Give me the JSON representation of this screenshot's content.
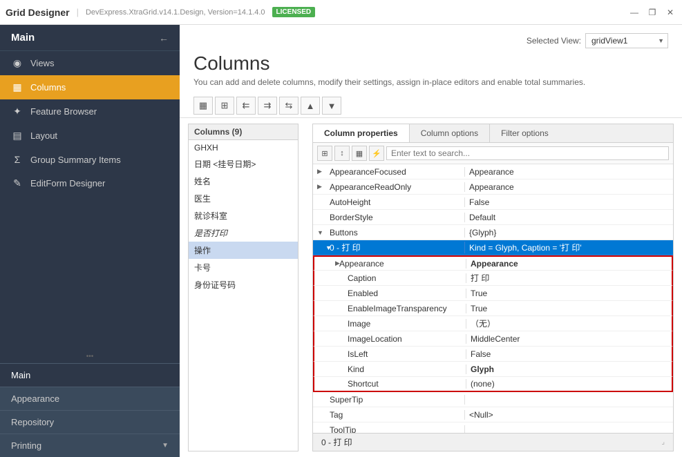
{
  "titleBar": {
    "appName": "Grid Designer",
    "subtitle": "DevExpress.XtraGrid.v14.1.Design, Version=14.1.4.0",
    "badge": "LICENSED",
    "minimizeBtn": "—",
    "restoreBtn": "❐",
    "closeBtn": "✕"
  },
  "sidebar": {
    "mainHeader": "Main",
    "arrowIcon": "←",
    "navItems": [
      {
        "id": "views",
        "icon": "◉",
        "label": "Views",
        "active": false
      },
      {
        "id": "columns",
        "icon": "▦",
        "label": "Columns",
        "active": true
      },
      {
        "id": "featureBrowser",
        "icon": "✦",
        "label": "Feature Browser",
        "active": false
      },
      {
        "id": "layout",
        "icon": "▤",
        "label": "Layout",
        "active": false
      },
      {
        "id": "groupSummaryItems",
        "icon": "Σ",
        "label": "Group Summary Items",
        "active": false
      },
      {
        "id": "editFormDesigner",
        "icon": "✎",
        "label": "EditForm Designer",
        "active": false
      }
    ],
    "accordionSections": [
      {
        "id": "main",
        "label": "Main",
        "active": true
      },
      {
        "id": "appearance",
        "label": "Appearance",
        "active": false
      },
      {
        "id": "repository",
        "label": "Repository",
        "active": false
      },
      {
        "id": "printing",
        "label": "Printing",
        "active": false
      }
    ],
    "bottomArrow": "▼"
  },
  "page": {
    "title": "Columns",
    "description": "You can add and delete columns, modify their settings, assign in-place editors and enable total summaries."
  },
  "viewSelector": {
    "label": "Selected View:",
    "value": "gridView1"
  },
  "toolbar": {
    "buttons": [
      "▦",
      "⊞",
      "⇇",
      "⇉",
      "⇆",
      "▲",
      "▼"
    ]
  },
  "columnsPanel": {
    "title": "Columns (9)",
    "items": [
      {
        "id": "ghxh",
        "label": "GHXH",
        "italic": false,
        "selected": false
      },
      {
        "id": "date",
        "label": "日期 <挂号日期>",
        "italic": false,
        "selected": false
      },
      {
        "id": "name",
        "label": "姓名",
        "italic": false,
        "selected": false
      },
      {
        "id": "doctor",
        "label": "医生",
        "italic": false,
        "selected": false
      },
      {
        "id": "department",
        "label": "就诊科室",
        "italic": false,
        "selected": false
      },
      {
        "id": "print_yn",
        "label": "是否打印",
        "italic": true,
        "selected": false
      },
      {
        "id": "operation",
        "label": "操作",
        "italic": false,
        "selected": true
      },
      {
        "id": "card",
        "label": "卡号",
        "italic": false,
        "selected": false
      },
      {
        "id": "idcard",
        "label": "身份证号码",
        "italic": false,
        "selected": false
      }
    ]
  },
  "tabs": [
    {
      "id": "columnProperties",
      "label": "Column properties",
      "active": true
    },
    {
      "id": "columnOptions",
      "label": "Column options",
      "active": false
    },
    {
      "id": "filterOptions",
      "label": "Filter options",
      "active": false
    }
  ],
  "propsToolbar": {
    "btn1": "⊞",
    "btn2": "↕",
    "btn3": "▦",
    "btn4": "⚡",
    "searchPlaceholder": "Enter text to search..."
  },
  "properties": [
    {
      "id": "appearanceFocused",
      "name": "AppearanceFocused",
      "value": "Appearance",
      "indent": 1,
      "expandable": true,
      "expanded": false
    },
    {
      "id": "appearanceReadOnly",
      "name": "AppearanceReadOnly",
      "value": "Appearance",
      "indent": 1,
      "expandable": true,
      "expanded": false
    },
    {
      "id": "autoHeight",
      "name": "AutoHeight",
      "value": "False",
      "indent": 1,
      "bold": false
    },
    {
      "id": "borderStyle",
      "name": "BorderStyle",
      "value": "Default",
      "indent": 1
    },
    {
      "id": "buttons",
      "name": "Buttons",
      "value": "{Glyph}",
      "indent": 1,
      "expandable": true,
      "expanded": true
    },
    {
      "id": "btn0",
      "name": "0 - 打 印",
      "value": "Kind = Glyph, Caption = '打 印'",
      "indent": 2,
      "expandable": true,
      "expanded": true,
      "highlighted": "blue"
    },
    {
      "id": "appearance_sub",
      "name": "Appearance",
      "value": "Appearance",
      "indent": 3,
      "expandable": true,
      "expanded": false,
      "redBorder": true
    },
    {
      "id": "caption",
      "name": "Caption",
      "value": "打 印",
      "indent": 3,
      "redBorder": true
    },
    {
      "id": "enabled",
      "name": "Enabled",
      "value": "True",
      "indent": 3,
      "redBorder": true
    },
    {
      "id": "enableImageTransparency",
      "name": "EnableImageTransparency",
      "value": "True",
      "indent": 3,
      "redBorder": true
    },
    {
      "id": "image",
      "name": "Image",
      "value": "（无）",
      "indent": 3,
      "redBorder": true
    },
    {
      "id": "imageLocation",
      "name": "ImageLocation",
      "value": "MiddleCenter",
      "indent": 3,
      "redBorder": true
    },
    {
      "id": "isLeft",
      "name": "IsLeft",
      "value": "False",
      "indent": 3,
      "redBorder": true
    },
    {
      "id": "kind",
      "name": "Kind",
      "value": "Glyph",
      "indent": 3,
      "bold": true,
      "redBorder": true
    },
    {
      "id": "shortcut",
      "name": "Shortcut",
      "value": "(none)",
      "indent": 3,
      "redBorder": true,
      "redBorderBottom": true
    },
    {
      "id": "superTip",
      "name": "SuperTip",
      "value": "",
      "indent": 1
    },
    {
      "id": "tag",
      "name": "Tag",
      "value": "<Null>",
      "indent": 1
    },
    {
      "id": "toolTip",
      "name": "ToolTip",
      "value": "",
      "indent": 1
    }
  ],
  "statusBar": {
    "text": "0 - 打 印"
  }
}
